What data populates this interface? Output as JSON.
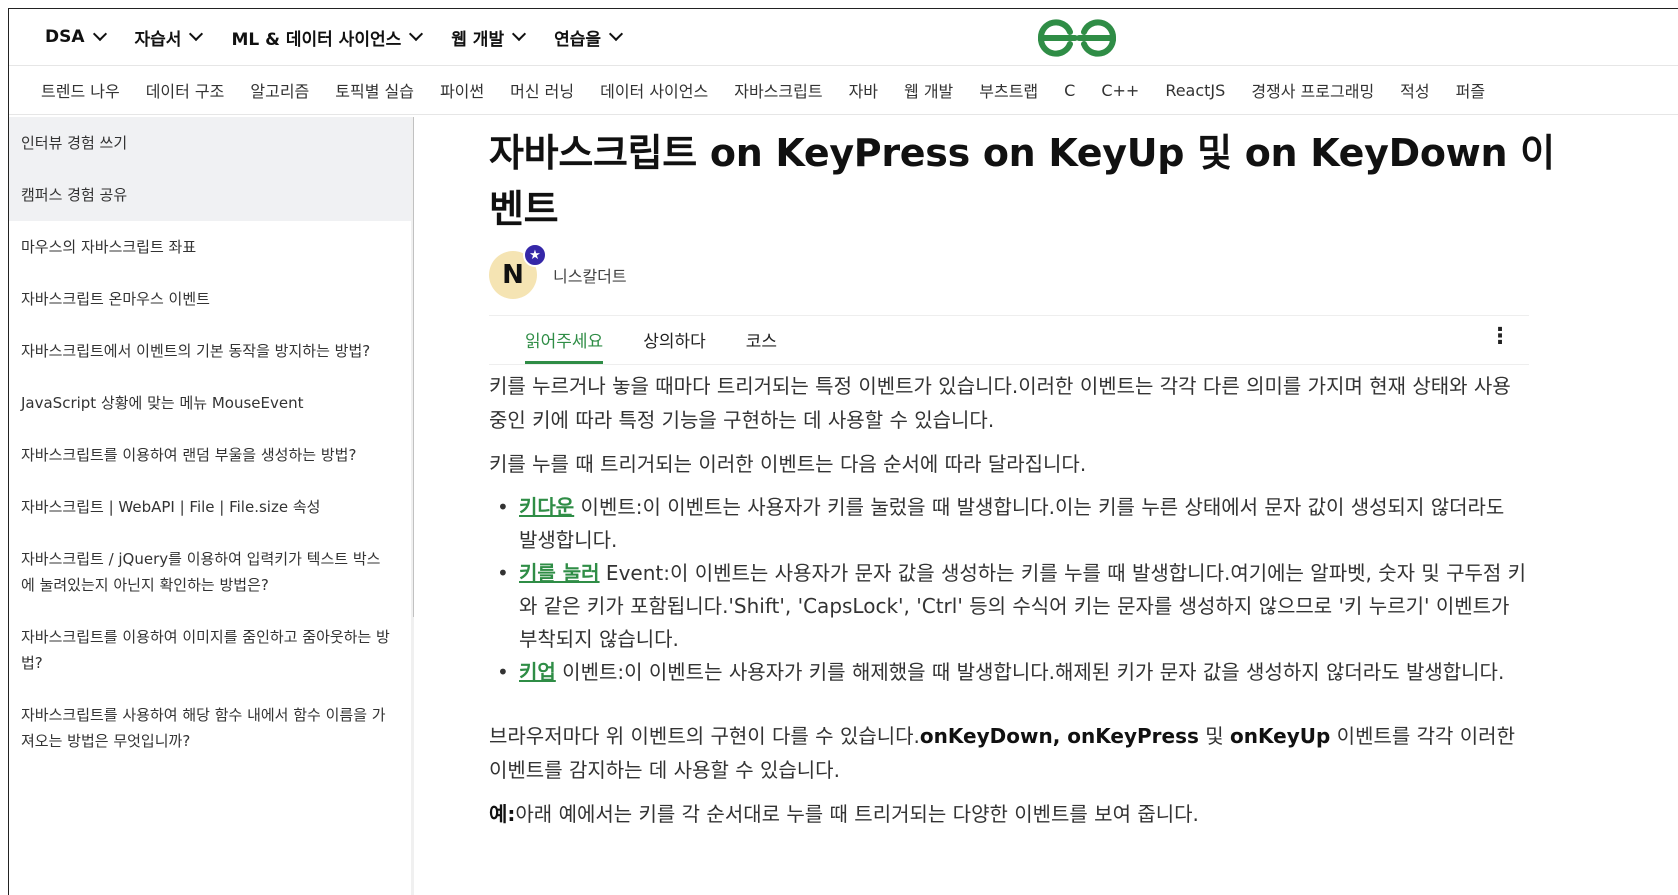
{
  "topnav": {
    "items": [
      {
        "label": "DSA"
      },
      {
        "label": "자습서"
      },
      {
        "label": "ML & 데이터 사이언스"
      },
      {
        "label": "웹 개발"
      },
      {
        "label": "연습을"
      }
    ],
    "logo_color": "#2f8d46"
  },
  "subnav": {
    "items": [
      "트렌드 나우",
      "데이터 구조",
      "알고리즘",
      "토픽별 실습",
      "파이썬",
      "머신 러닝",
      "데이터 사이언스",
      "자바스크립트",
      "자바",
      "웹 개발",
      "부츠트랩",
      "C",
      "C++",
      "ReactJS",
      "경쟁사 프로그래밍",
      "적성",
      "퍼즐"
    ]
  },
  "sidebar": {
    "items": [
      {
        "label": "인터뷰 경험 쓰기"
      },
      {
        "label": "캠퍼스 경험 공유"
      },
      {
        "label": "마우스의 자바스크립트 좌표"
      },
      {
        "label": "자바스크립트 온마우스 이벤트"
      },
      {
        "label": "자바스크립트에서 이벤트의 기본 동작을 방지하는 방법?"
      },
      {
        "label": "JavaScript 상황에 맞는 메뉴 MouseEvent"
      },
      {
        "label": "자바스크립트를 이용하여 랜덤 부울을 생성하는 방법?"
      },
      {
        "label": "자바스크립트 | WebAPI | File | File.size 속성"
      },
      {
        "label": "자바스크립트 / jQuery를 이용하여 입력키가 텍스트 박스에 눌려있는지 아닌지 확인하는 방법은?"
      },
      {
        "label": "자바스크립트를 이용하여 이미지를 줌인하고 줌아웃하는 방법?"
      },
      {
        "label": "자바스크립트를 사용하여 해당 함수 내에서 함수 이름을 가져오는 방법은 무엇입니까?"
      }
    ]
  },
  "article": {
    "title": "자바스크립트 on KeyPress on KeyUp 및 on KeyDown 이벤트",
    "author": {
      "initial": "N",
      "badge": "★",
      "name": "니스칼더트"
    },
    "tabs": [
      {
        "label": "읽어주세요"
      },
      {
        "label": "상의하다"
      },
      {
        "label": "코스"
      }
    ],
    "menu_glyph": "⋮",
    "intro": "키를 누르거나 놓을 때마다 트리거되는 특정 이벤트가 있습니다.이러한 이벤트는 각각 다른 의미를 가지며 현재 상태와 사용 중인 키에 따라 특정 기능을 구현하는 데 사용할 수 있습니다.",
    "order_line": "키를 누를 때 트리거되는 이러한 이벤트는 다음 순서에 따라 달라집니다.",
    "events": [
      {
        "link": "키다운",
        "text": " 이벤트:이 이벤트는 사용자가 키를 눌렀을 때 발생합니다.이는 키를 누른 상태에서 문자 값이 생성되지 않더라도 발생합니다."
      },
      {
        "link": "키를 눌러",
        "text": " Event:이 이벤트는 사용자가 문자 값을 생성하는 키를 누를 때 발생합니다.여기에는 알파벳, 숫자 및 구두점 키와 같은 키가 포함됩니다.'Shift', 'CapsLock', 'Ctrl' 등의 수식어 키는 문자를 생성하지 않으므로 '키 누르기' 이벤트가 부착되지 않습니다."
      },
      {
        "link": "키업",
        "text": " 이벤트:이 이벤트는 사용자가 키를 해제했을 때 발생합니다.해제된 키가 문자 값을 생성하지 않더라도 발생합니다."
      }
    ],
    "browser_note": {
      "before": "브라우저마다 위 이벤트의 구현이 다를 수 있습니다.",
      "k1": "onKeyDown",
      "sep1": ", ",
      "k2": "onKeyPress",
      "sep2": " 및 ",
      "k3": "onKeyUp",
      "after": " 이벤트를 각각 이러한 이벤트를 감지하는 데 사용할 수 있습니다."
    },
    "example": {
      "label": "예:",
      "text": "아래 예에서는 키를 각 순서대로 누를 때 트리거되는 다양한 이벤트를 보여 줍니다."
    }
  }
}
